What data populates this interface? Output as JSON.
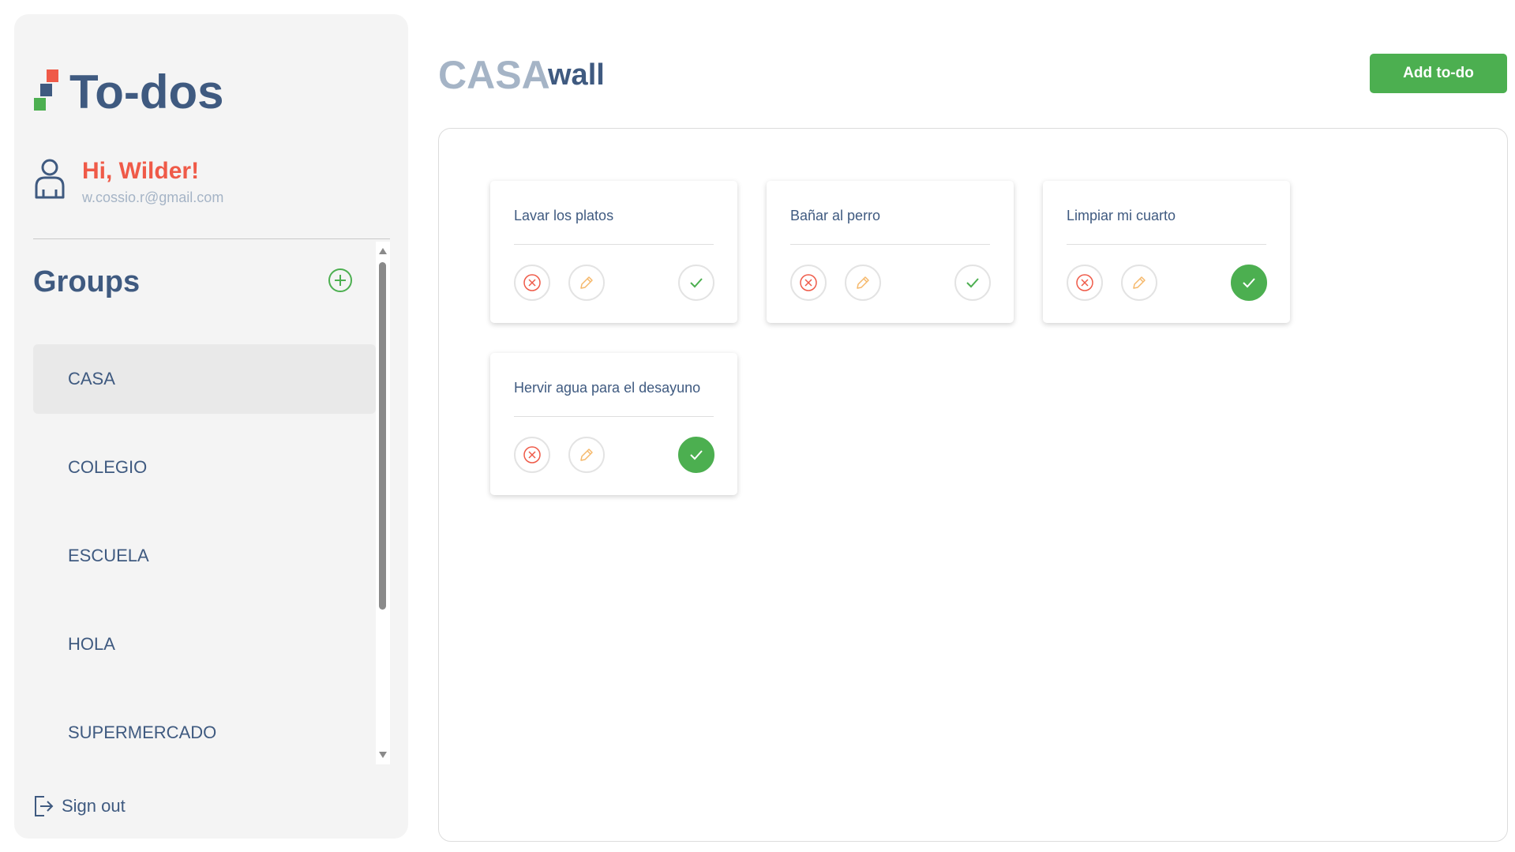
{
  "app": {
    "title": "To-dos"
  },
  "user": {
    "greeting": "Hi, Wilder!",
    "email": "w.cossio.r@gmail.com"
  },
  "sidebar": {
    "groups_title": "Groups",
    "groups": [
      {
        "label": "CASA",
        "active": true
      },
      {
        "label": "COLEGIO",
        "active": false
      },
      {
        "label": "ESCUELA",
        "active": false
      },
      {
        "label": "HOLA",
        "active": false
      },
      {
        "label": "SUPERMERCADO",
        "active": false
      }
    ],
    "signout_label": "Sign out"
  },
  "header": {
    "group_name": "CASA",
    "user_name": "wall",
    "add_todo_label": "Add to-do"
  },
  "todos": [
    {
      "text": "Lavar los platos",
      "done": false
    },
    {
      "text": "Bañar al perro",
      "done": false
    },
    {
      "text": "Limpiar mi cuarto",
      "done": true
    },
    {
      "text": "Hervir agua para el desayuno",
      "done": true
    }
  ],
  "colors": {
    "brand_blue": "#3f5a80",
    "accent_red": "#ef5a48",
    "accent_green": "#4caf50",
    "edit_orange": "#f5b86b",
    "muted": "#a5b4c6"
  },
  "icons": {
    "logo": "todos-logo-icon",
    "user": "user-icon",
    "add_group": "plus-circle-icon",
    "signout": "sign-out-icon",
    "delete": "close-circle-icon",
    "edit": "pencil-icon",
    "complete": "check-icon"
  }
}
